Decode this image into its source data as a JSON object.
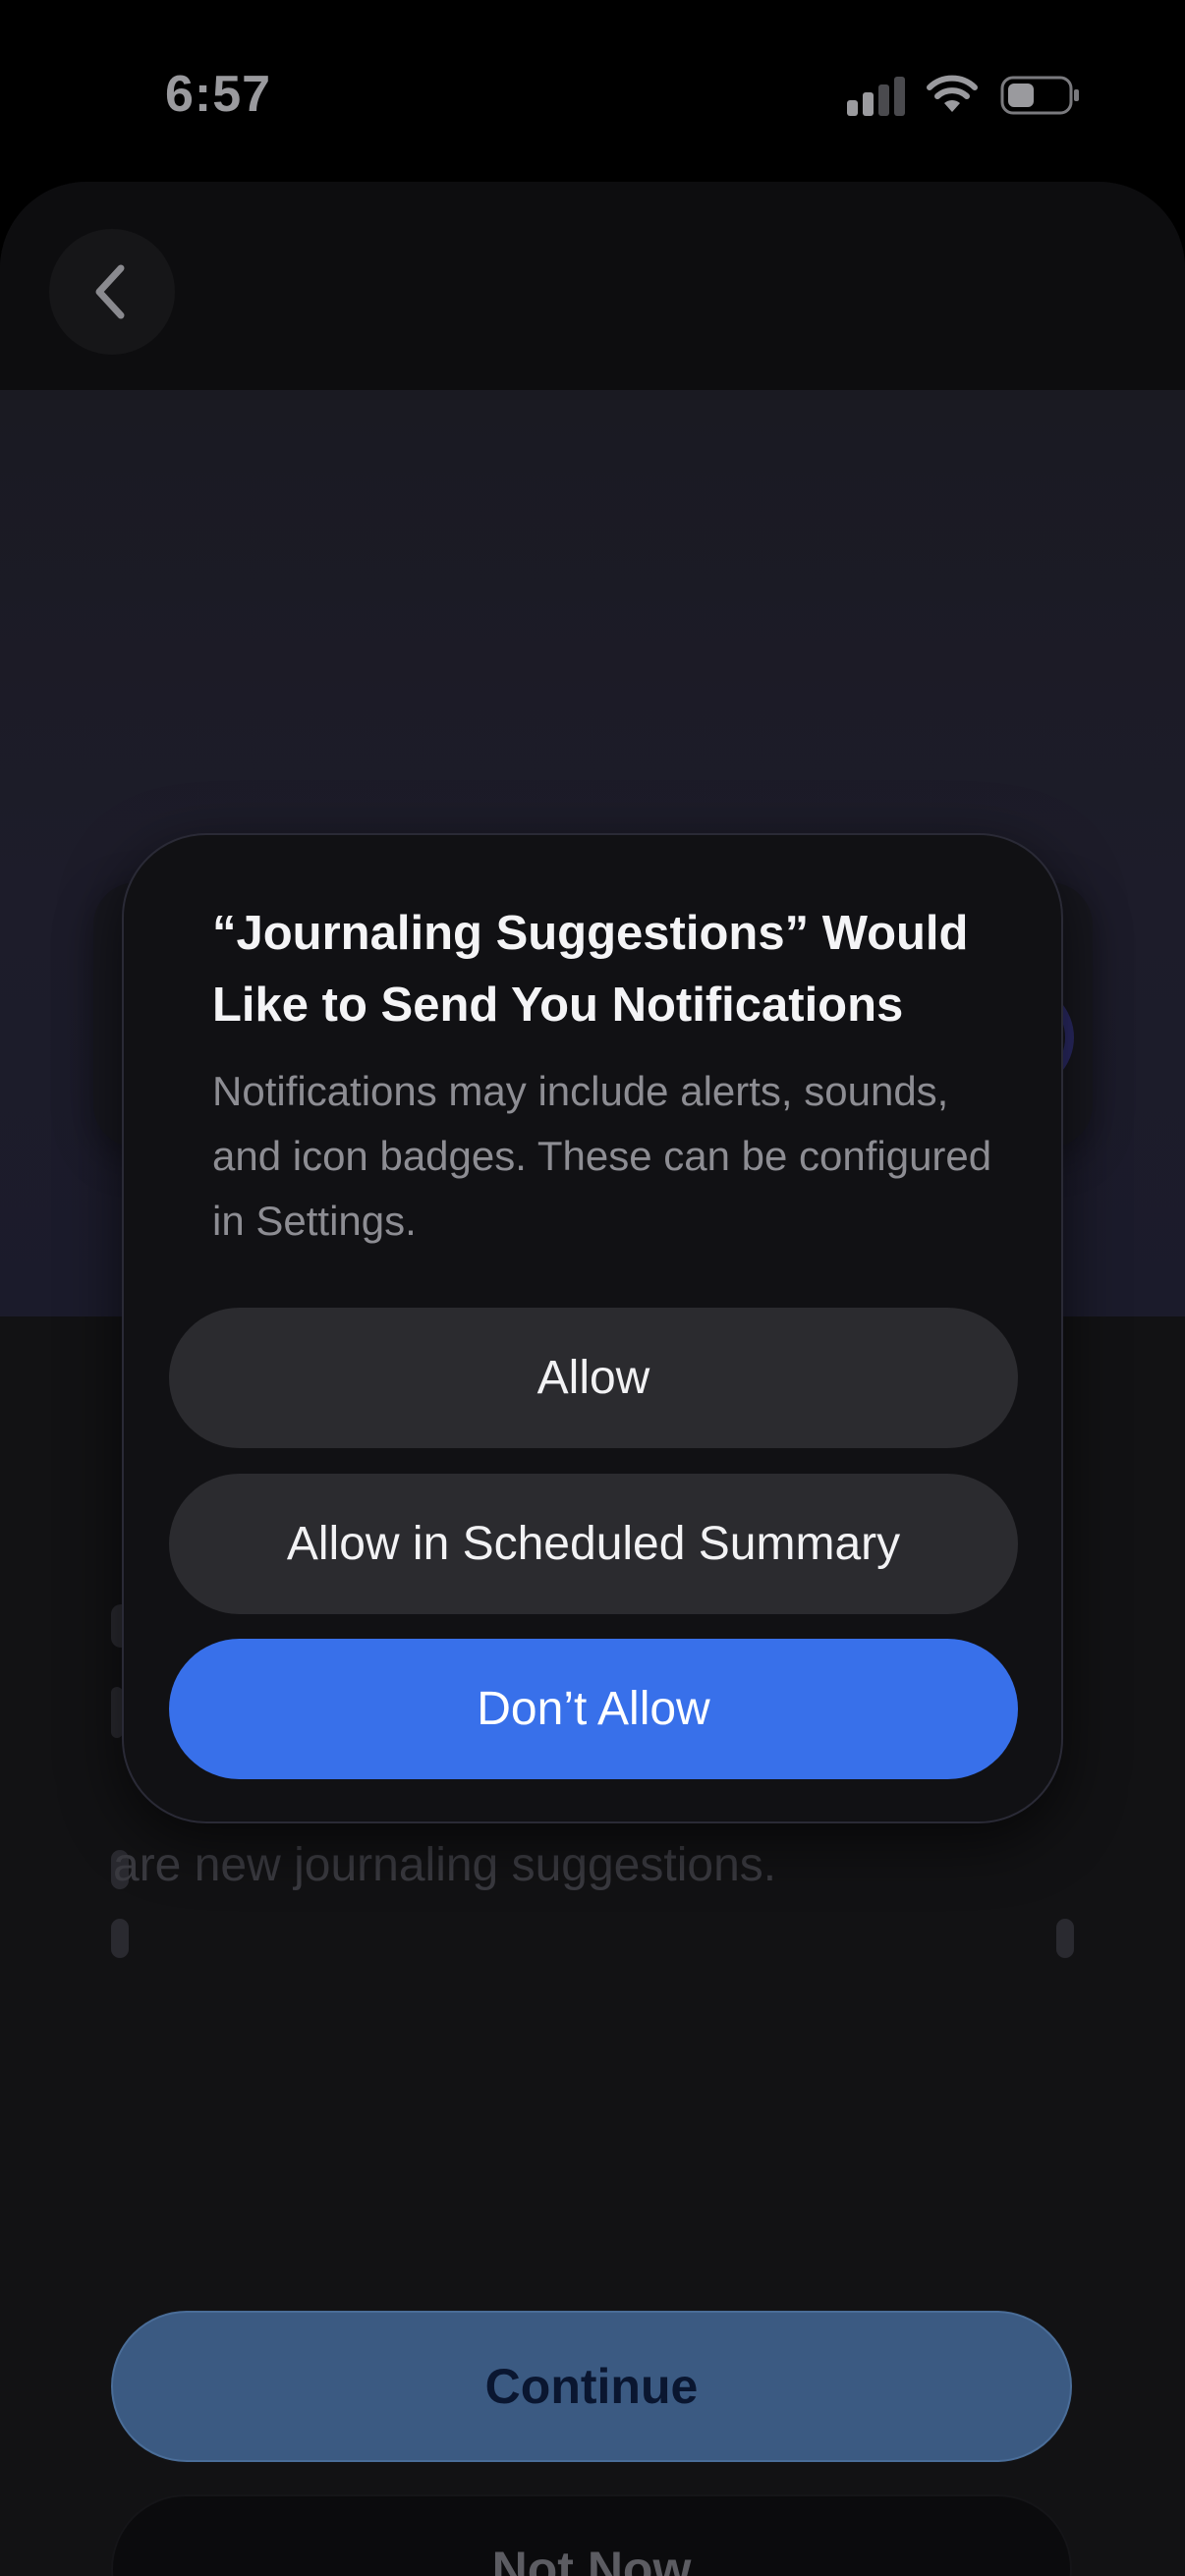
{
  "status_bar": {
    "time": "6:57",
    "signal_icon": "cellular-signal-icon",
    "wifi_icon": "wifi-icon",
    "battery_icon": "battery-icon"
  },
  "header": {
    "back_icon": "chevron-left-icon"
  },
  "tracker": {
    "days": [
      {
        "state": "filled"
      },
      {
        "state": "empty"
      },
      {
        "state": "empty"
      },
      {
        "state": "filled"
      },
      {
        "state": "empty"
      },
      {
        "state": "empty"
      },
      {
        "state": "empty"
      }
    ]
  },
  "page": {
    "description_tail": "are new journaling suggestions."
  },
  "actions": {
    "continue_label": "Continue",
    "not_now_label": "Not Now"
  },
  "alert": {
    "title": "“Journaling Suggestions” Would Like to Send You Notifications",
    "message": "Notifications may include alerts, sounds, and icon badges. These can be configured in Settings.",
    "allow_label": "Allow",
    "summary_label": "Allow in Scheduled Summary",
    "dont_allow_label": "Don’t Allow"
  },
  "colors": {
    "accent_blue": "#3870ea",
    "continue_bg": "#3b5a82",
    "tracker_filled": "#34307c",
    "tracker_outline": "#2b2a66"
  }
}
